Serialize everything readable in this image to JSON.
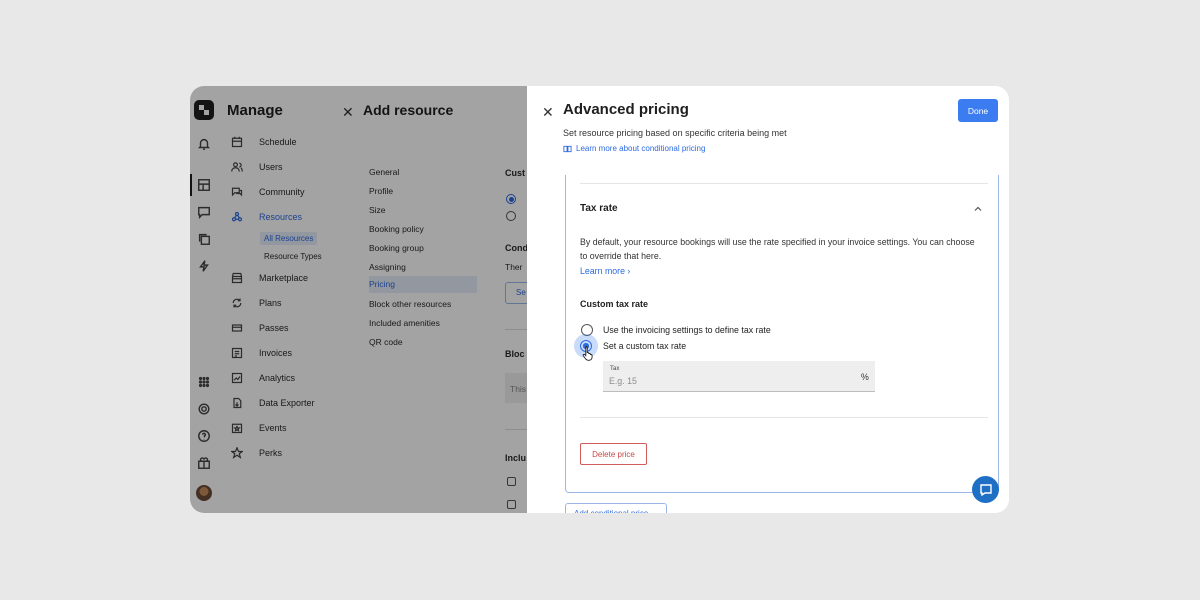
{
  "sidebar": {
    "title": "Manage",
    "items": [
      {
        "label": "Schedule",
        "icon": "calendar-icon"
      },
      {
        "label": "Users",
        "icon": "users-icon"
      },
      {
        "label": "Community",
        "icon": "chat-icon"
      },
      {
        "label": "Resources",
        "icon": "resources-icon",
        "active": true
      },
      {
        "label": "Marketplace",
        "icon": "store-icon"
      },
      {
        "label": "Plans",
        "icon": "refresh-icon"
      },
      {
        "label": "Passes",
        "icon": "pass-icon"
      },
      {
        "label": "Invoices",
        "icon": "invoice-icon"
      },
      {
        "label": "Analytics",
        "icon": "analytics-icon"
      },
      {
        "label": "Data Exporter",
        "icon": "export-icon"
      },
      {
        "label": "Events",
        "icon": "events-icon"
      },
      {
        "label": "Perks",
        "icon": "star-icon"
      }
    ],
    "sub_items": [
      "All Resources",
      "Resource Types"
    ]
  },
  "add_resource": {
    "title": "Add resource",
    "menu": [
      "General",
      "Profile",
      "Size",
      "Booking policy",
      "Booking group",
      "Assigning",
      "Pricing",
      "Block other resources",
      "Included amenities",
      "QR code"
    ],
    "active_menu": "Pricing",
    "cut_texts": {
      "custom": "Cust",
      "conditional": "Cond",
      "there": "Ther",
      "set": "Se",
      "block": "Bloc",
      "this": "This",
      "included": "Inclu"
    }
  },
  "advanced_pricing": {
    "title": "Advanced pricing",
    "subtitle": "Set resource pricing based on specific criteria being met",
    "learn_link": "Learn more about conditional pricing",
    "done_label": "Done",
    "section_title": "Tax rate",
    "description": "By default, your resource bookings will use the rate specified in your invoice settings. You can choose to override that here.",
    "learn_more": "Learn more ›",
    "custom_tax_title": "Custom tax rate",
    "options": [
      {
        "label": "Use the invoicing settings to define tax rate",
        "selected": false
      },
      {
        "label": "Set a custom tax rate",
        "selected": true
      }
    ],
    "tax_field": {
      "label": "Tax",
      "placeholder": "E.g. 15",
      "suffix": "%"
    },
    "delete_label": "Delete price",
    "add_condition_label": "Add conditional price"
  },
  "colors": {
    "accent": "#2d6ae0",
    "primary_button": "#3b7cf0",
    "danger": "#c84646"
  }
}
